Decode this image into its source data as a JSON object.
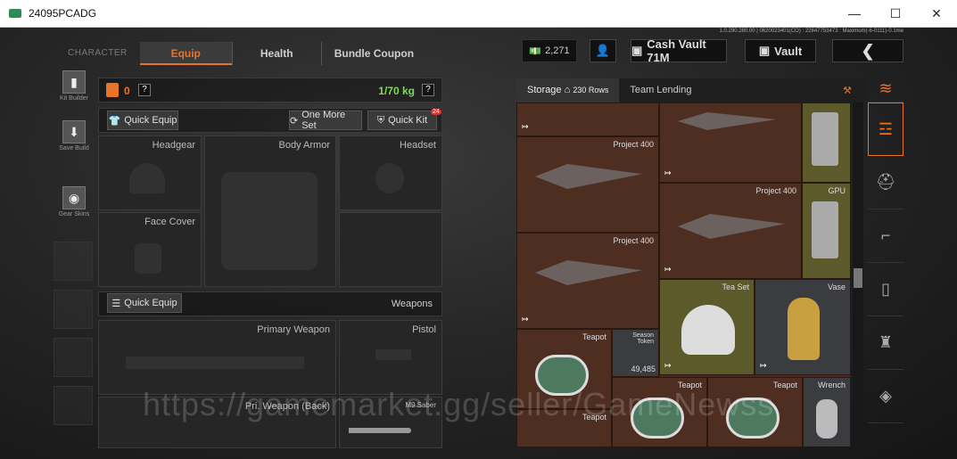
{
  "window": {
    "title": "24095PCADG",
    "minimize": "—",
    "maximize": "☐",
    "close": "✕"
  },
  "topnav": {
    "tabs": [
      {
        "label": "CHARACTER"
      },
      {
        "label": "Equip"
      },
      {
        "label": "Health"
      },
      {
        "label": "Bundle Coupon"
      }
    ]
  },
  "header": {
    "currency": "2,271",
    "cash_vault": "Cash Vault 71M",
    "vault": "Vault",
    "debug_text": "1.0.290.280.00 | 0620023401(CO) : 22847753473 : Maximum(-6-0111)-0.1me"
  },
  "sidebar": {
    "items": [
      {
        "label": "Kit Builder",
        "icon": "vest-icon"
      },
      {
        "label": "Save Build",
        "icon": "download-icon"
      },
      {
        "label": "Gear Skins",
        "icon": "helmet-icon"
      }
    ]
  },
  "loadout": {
    "armor_count": "0",
    "weight": "1/70 kg",
    "quick_equip": "Quick Equip",
    "one_more_set": "One More Set",
    "quick_kit": "Quick Kit",
    "quick_kit_badge": "24",
    "help": "?"
  },
  "slots": {
    "headgear": "Headgear",
    "body_armor": "Body Armor",
    "headset": "Headset",
    "face_cover": "Face Cover"
  },
  "weapons": {
    "quick_equip": "Quick Equip",
    "title": "Weapons",
    "primary": "Primary Weapon",
    "pistol": "Pistol",
    "pri_back": "Pri. Weapon (Back)",
    "melee": "M9 Saber"
  },
  "storage": {
    "tab": "Storage",
    "rows": "230 Rows",
    "team_lending": "Team Lending"
  },
  "items": {
    "project1": "Project 400",
    "project2": "Project 400",
    "project3": "Project 400",
    "gpu": "GPU",
    "tea_set": "Tea Set",
    "vase": "Vase",
    "teapot1": "Teapot",
    "season": "Season Token",
    "season_count": "49,485",
    "teapot2": "Teapot",
    "teapot3": "Teapot",
    "wrench": "Wrench",
    "teapot4": "Teapot"
  },
  "watermark": "https://gamemarket.gg/seller/GameNewss",
  "colors": {
    "accent": "#e8742a",
    "weight": "#7ed957"
  }
}
